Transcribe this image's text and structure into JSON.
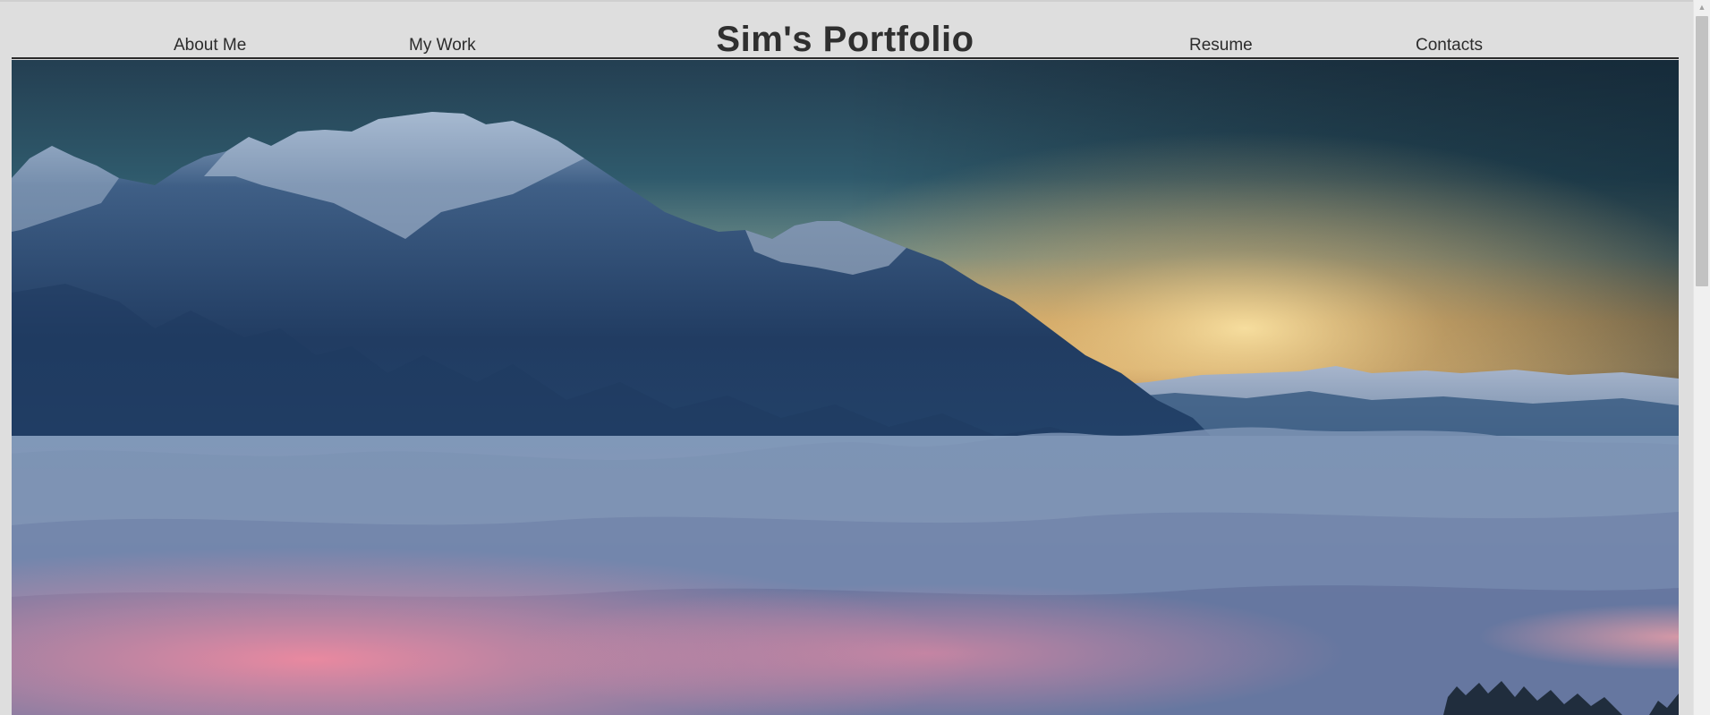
{
  "nav": {
    "links": [
      {
        "label": "About Me"
      },
      {
        "label": "My Work"
      },
      {
        "label": "Resume"
      },
      {
        "label": "Contacts"
      }
    ],
    "title": "Sim's Portfolio"
  },
  "hero": {
    "image": "mountain-sunrise-above-clouds-photo"
  },
  "colors": {
    "page_background": "#dedede",
    "text": "#2f2f2f",
    "rule": "#2a2a2a"
  }
}
